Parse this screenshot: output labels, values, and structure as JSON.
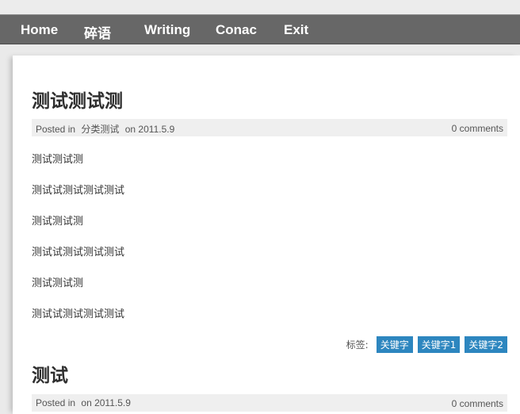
{
  "nav": {
    "items": [
      {
        "label": "Home"
      },
      {
        "label": "碎语"
      },
      {
        "label": "Writing"
      },
      {
        "label": "Conac"
      },
      {
        "label": "Exit"
      }
    ]
  },
  "posts": [
    {
      "title": "测试测试测",
      "meta": {
        "posted_in": "Posted in",
        "category": "分类测试",
        "date": "on 2011.5.9",
        "comments": "0 comments"
      },
      "paragraphs": [
        "测试测试测",
        "测试试测试测试测试",
        "测试测试测",
        "测试试测试测试测试",
        "测试测试测",
        "测试试测试测试测试"
      ],
      "tags_label": "标签:",
      "tags": [
        "关键字",
        "关键字1",
        "关键字2"
      ]
    },
    {
      "title": "测试",
      "meta": {
        "posted_in": "Posted in",
        "date": "on 2011.5.9",
        "comments": "0 comments"
      }
    }
  ]
}
